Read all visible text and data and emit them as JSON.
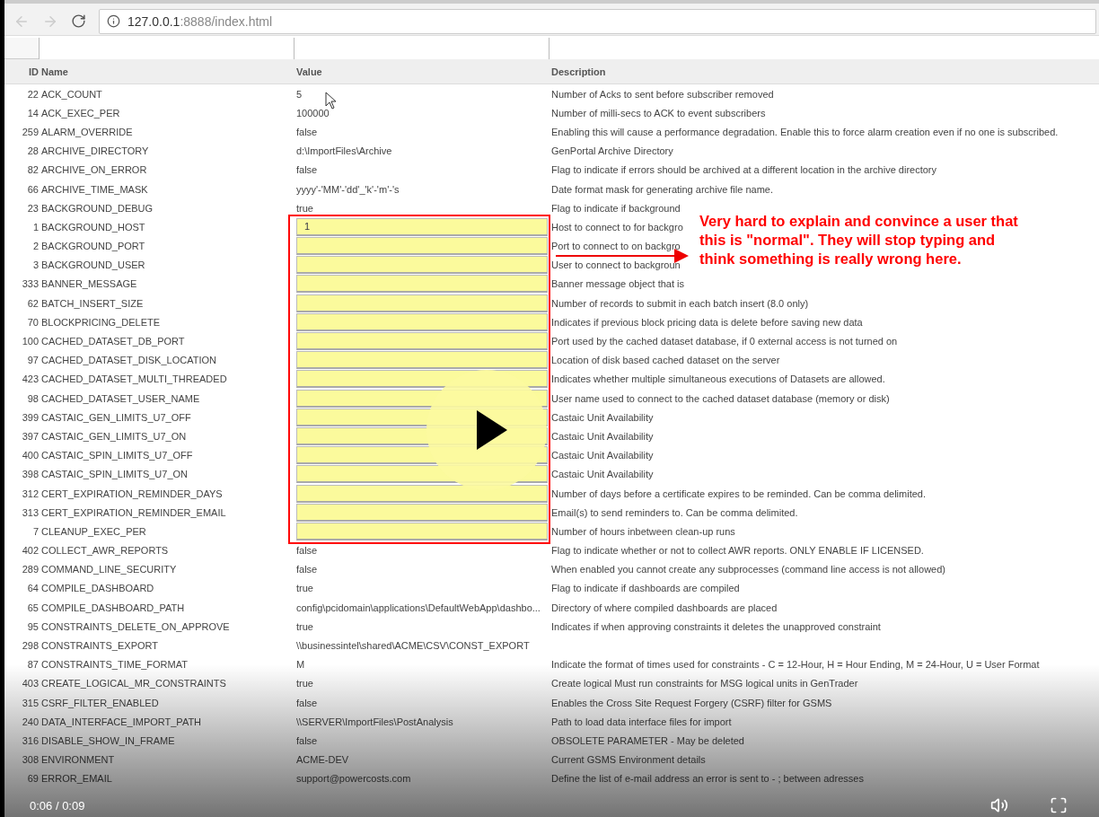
{
  "browser": {
    "url_host": "127.0.0.1",
    "url_path": ":8888/index.html"
  },
  "table": {
    "columns": [
      "ID",
      "Name",
      "Value",
      "Description"
    ],
    "rows": [
      {
        "id": "22",
        "name": "ACK_COUNT",
        "kind": "text",
        "value": "5",
        "description": "Number of Acks to sent before subscriber removed"
      },
      {
        "id": "14",
        "name": "ACK_EXEC_PER",
        "kind": "text",
        "value": "100000",
        "description": "Number of milli-secs to ACK to event subscribers"
      },
      {
        "id": "259",
        "name": "ALARM_OVERRIDE",
        "kind": "text",
        "value": "false",
        "description": "Enabling this will cause a performance degradation. Enable this to force alarm creation even if no one is subscribed."
      },
      {
        "id": "28",
        "name": "ARCHIVE_DIRECTORY",
        "kind": "text",
        "value": "d:\\ImportFiles\\Archive",
        "description": "GenPortal Archive Directory"
      },
      {
        "id": "82",
        "name": "ARCHIVE_ON_ERROR",
        "kind": "text",
        "value": "false",
        "description": "Flag to indicate if errors should be archived at a different location in the archive directory"
      },
      {
        "id": "66",
        "name": "ARCHIVE_TIME_MASK",
        "kind": "text",
        "value": "yyyy'-'MM'-'dd'_'k'-'m'-'s",
        "description": "Date format mask for generating archive file name."
      },
      {
        "id": "23",
        "name": "BACKGROUND_DEBUG",
        "kind": "text",
        "value": "true",
        "description": "Flag to indicate if background"
      },
      {
        "id": "1",
        "name": "BACKGROUND_HOST",
        "kind": "input",
        "value": "1",
        "description": "Host to connect to for backgro"
      },
      {
        "id": "2",
        "name": "BACKGROUND_PORT",
        "kind": "input",
        "description": "Port to connect to on backgro"
      },
      {
        "id": "3",
        "name": "BACKGROUND_USER",
        "kind": "input",
        "description": "User to connect to backgroun"
      },
      {
        "id": "333",
        "name": "BANNER_MESSAGE",
        "kind": "input",
        "description": "Banner message object that is"
      },
      {
        "id": "62",
        "name": "BATCH_INSERT_SIZE",
        "kind": "input",
        "description": "Number of records to submit in each batch insert (8.0 only)"
      },
      {
        "id": "70",
        "name": "BLOCKPRICING_DELETE",
        "kind": "input",
        "description": "Indicates if previous block pricing data is delete before saving new data"
      },
      {
        "id": "100",
        "name": "CACHED_DATASET_DB_PORT",
        "kind": "input",
        "description": "Port used by the cached dataset database, if 0 external access is not turned on"
      },
      {
        "id": "97",
        "name": "CACHED_DATASET_DISK_LOCATION",
        "kind": "input",
        "description": "Location of disk based cached dataset on the server"
      },
      {
        "id": "423",
        "name": "CACHED_DATASET_MULTI_THREADED",
        "kind": "input",
        "description": "Indicates whether multiple simultaneous executions of Datasets are allowed."
      },
      {
        "id": "98",
        "name": "CACHED_DATASET_USER_NAME",
        "kind": "input",
        "description": "User name used to connect to the cached dataset database (memory or disk)"
      },
      {
        "id": "399",
        "name": "CASTAIC_GEN_LIMITS_U7_OFF",
        "kind": "input",
        "description": "Castaic Unit Availability"
      },
      {
        "id": "397",
        "name": "CASTAIC_GEN_LIMITS_U7_ON",
        "kind": "input",
        "description": "Castaic Unit Availability"
      },
      {
        "id": "400",
        "name": "CASTAIC_SPIN_LIMITS_U7_OFF",
        "kind": "input",
        "description": "Castaic Unit Availability"
      },
      {
        "id": "398",
        "name": "CASTAIC_SPIN_LIMITS_U7_ON",
        "kind": "input",
        "description": "Castaic Unit Availability"
      },
      {
        "id": "312",
        "name": "CERT_EXPIRATION_REMINDER_DAYS",
        "kind": "input",
        "description": "Number of days before a certificate expires to be reminded. Can be comma delimited."
      },
      {
        "id": "313",
        "name": "CERT_EXPIRATION_REMINDER_EMAIL",
        "kind": "input",
        "description": "Email(s) to send reminders to. Can be comma delimited."
      },
      {
        "id": "7",
        "name": "CLEANUP_EXEC_PER",
        "kind": "input",
        "description": "Number of hours inbetween clean-up runs"
      },
      {
        "id": "402",
        "name": "COLLECT_AWR_REPORTS",
        "kind": "text",
        "value": "false",
        "description": "Flag to indicate whether or not to collect AWR reports. ONLY ENABLE IF LICENSED."
      },
      {
        "id": "289",
        "name": "COMMAND_LINE_SECURITY",
        "kind": "text",
        "value": "false",
        "description": "When enabled you cannot create any subprocesses (command line access is not allowed)"
      },
      {
        "id": "64",
        "name": "COMPILE_DASHBOARD",
        "kind": "text",
        "value": "true",
        "description": "Flag to indicate if dashboards are compiled"
      },
      {
        "id": "65",
        "name": "COMPILE_DASHBOARD_PATH",
        "kind": "text",
        "value": "config\\pcidomain\\applications\\DefaultWebApp\\dashbo...",
        "description": "Directory of where compiled dashboards are placed"
      },
      {
        "id": "95",
        "name": "CONSTRAINTS_DELETE_ON_APPROVE",
        "kind": "text",
        "value": "true",
        "description": "Indicates if when approving constraints it deletes the unapproved constraint"
      },
      {
        "id": "298",
        "name": "CONSTRAINTS_EXPORT",
        "kind": "text",
        "value": "\\\\businessintel\\shared\\ACME\\CSV\\CONST_EXPORT"
      },
      {
        "id": "87",
        "name": "CONSTRAINTS_TIME_FORMAT",
        "kind": "text",
        "value": "M",
        "description": "Indicate the format of times used for constraints - C = 12-Hour, H = Hour Ending, M = 24-Hour, U = User Format"
      },
      {
        "id": "403",
        "name": "CREATE_LOGICAL_MR_CONSTRAINTS",
        "kind": "text",
        "value": "true",
        "description": "Create logical Must run constraints for MSG logical units in GenTrader"
      },
      {
        "id": "315",
        "name": "CSRF_FILTER_ENABLED",
        "kind": "text",
        "value": "false",
        "description": "Enables the Cross Site Request Forgery (CSRF) filter for GSMS"
      },
      {
        "id": "240",
        "name": "DATA_INTERFACE_IMPORT_PATH",
        "kind": "text",
        "value": "\\\\SERVER\\ImportFiles\\PostAnalysis",
        "description": "Path to load data interface files for import"
      },
      {
        "id": "316",
        "name": "DISABLE_SHOW_IN_FRAME",
        "kind": "text",
        "value": "false",
        "description": "OBSOLETE PARAMETER - May be deleted"
      },
      {
        "id": "308",
        "name": "ENVIRONMENT",
        "kind": "text",
        "value": "ACME-DEV",
        "description": "Current GSMS Environment details"
      },
      {
        "id": "69",
        "name": "ERROR_EMAIL",
        "kind": "text",
        "value": "support@powercosts.com",
        "description": "Define the list of e-mail address an error is sent to - ; between adresses"
      }
    ]
  },
  "annotation": {
    "text": "Very hard to explain and convince a user that this is \"normal\".  They will stop typing and think something is really wrong here."
  },
  "video": {
    "time": "0:06 / 0:09"
  }
}
